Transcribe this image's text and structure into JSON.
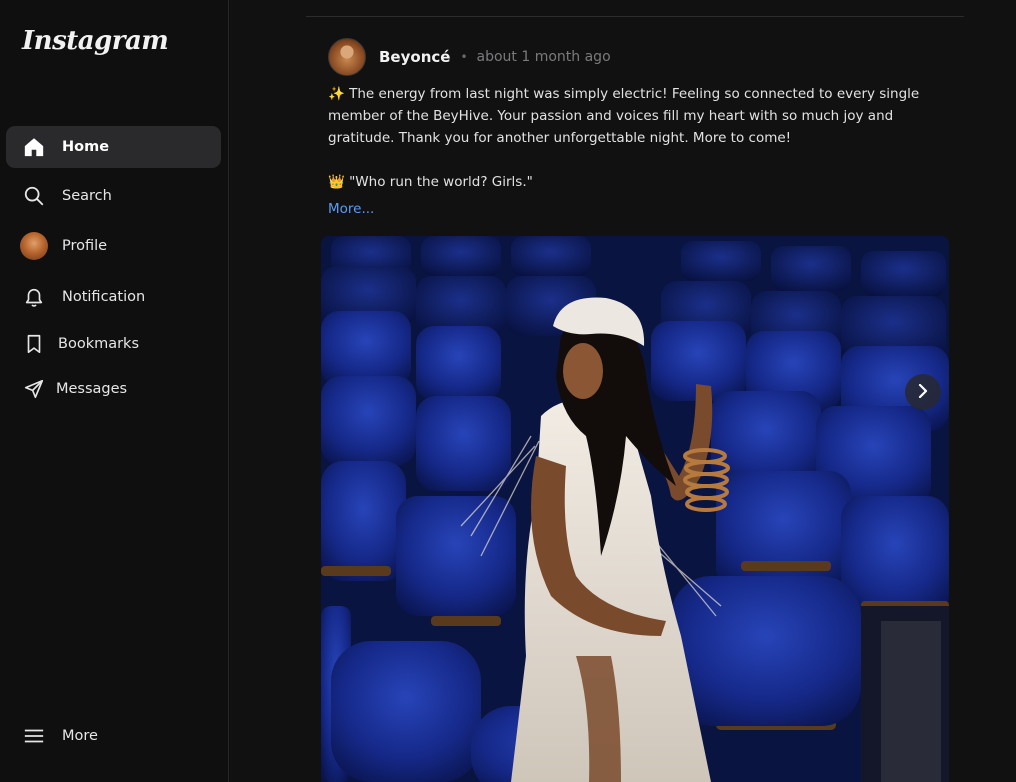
{
  "app": {
    "logo_text": "Instagram"
  },
  "sidebar": {
    "items": [
      {
        "label": "Home",
        "icon": "home-icon",
        "active": true
      },
      {
        "label": "Search",
        "icon": "search-icon",
        "active": false
      },
      {
        "label": "Profile",
        "icon": "avatar",
        "active": false
      },
      {
        "label": "Notification",
        "icon": "bell-icon",
        "active": false
      },
      {
        "label": "Bookmarks",
        "icon": "bookmark-icon",
        "active": false
      },
      {
        "label": "Messages",
        "icon": "send-icon",
        "active": false
      }
    ],
    "more_label": "More"
  },
  "post": {
    "author": "Beyoncé",
    "separator": "•",
    "timestamp": "about 1 month ago",
    "caption_line1": "✨ The energy from last night was simply electric! Feeling so connected to every single member of the BeyHive. Your passion and voices fill my heart with so much joy and gratitude. Thank you for another unforgettable night. More to come!",
    "caption_line2": "👑 \"Who run the world? Girls.\"",
    "more_link": "More..."
  },
  "colors": {
    "background": "#111112",
    "sidebar_active": "#2a2a2c",
    "link": "#5b9cf2",
    "seat_blue": "#1a2f86"
  }
}
